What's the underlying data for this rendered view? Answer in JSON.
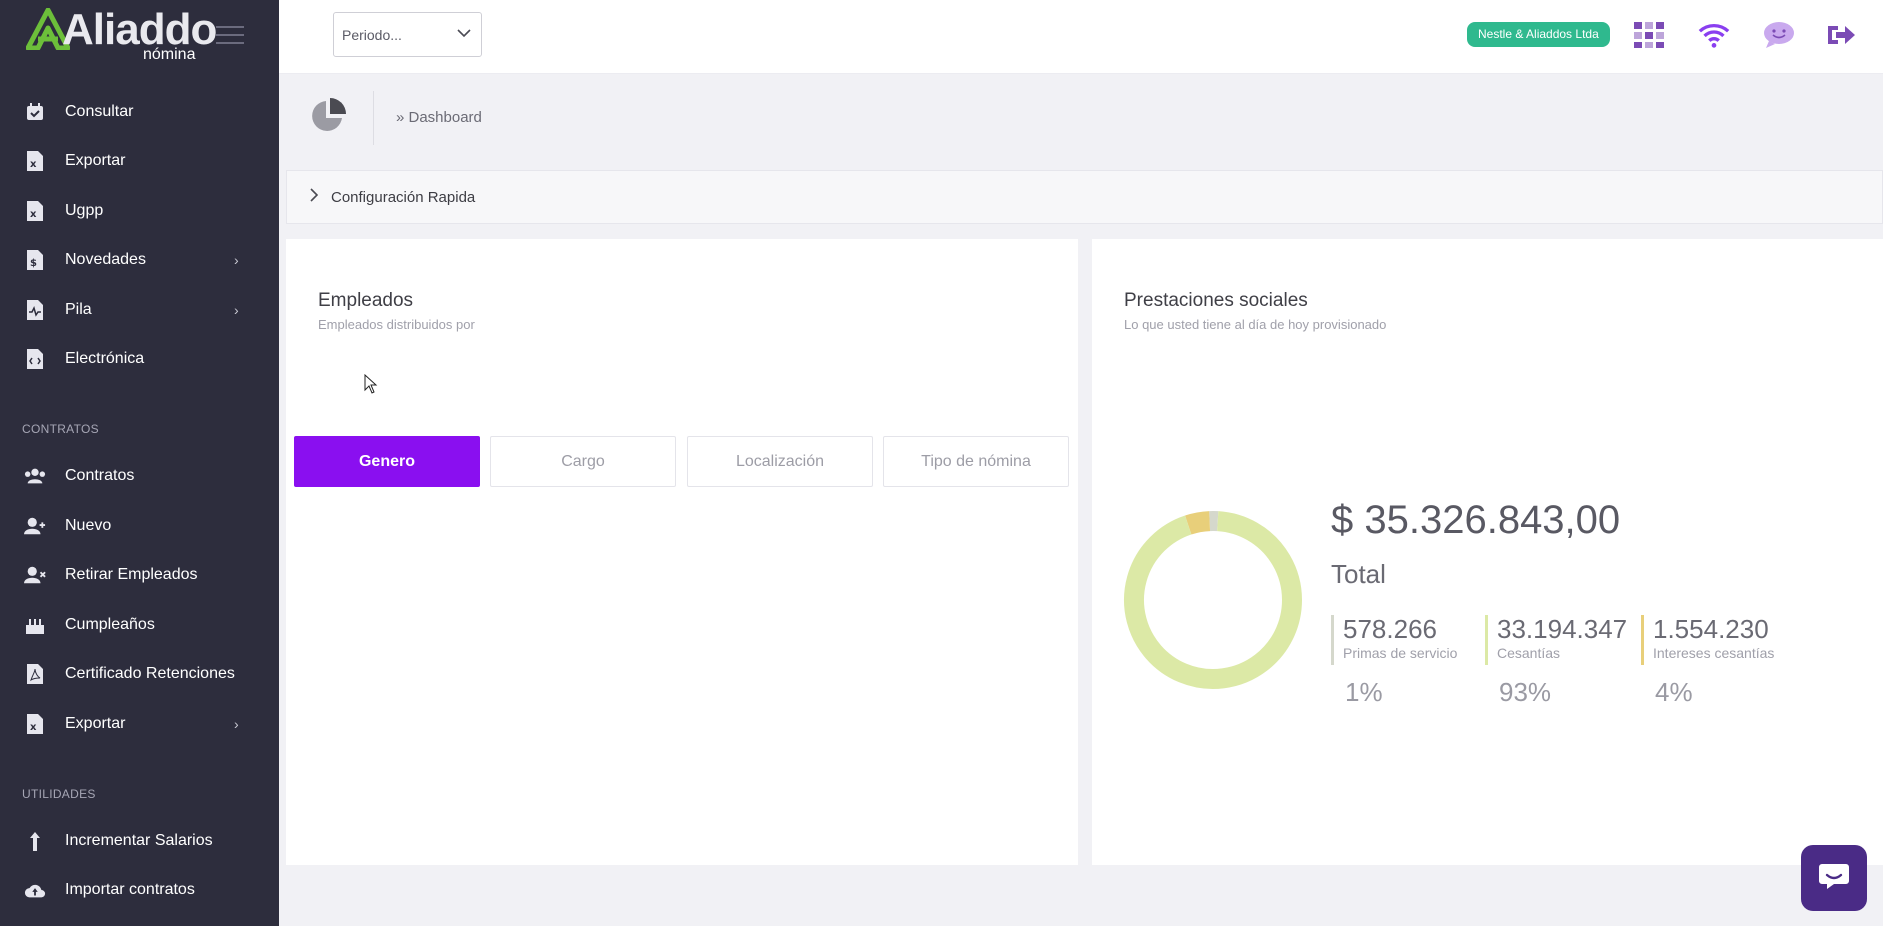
{
  "brand": {
    "name": "Aliaddo",
    "product": "nómina"
  },
  "sidebar": {
    "items": [
      {
        "label": "Consultar",
        "icon": "calendar-check-icon",
        "chevron": false
      },
      {
        "label": "Exportar",
        "icon": "excel-file-icon",
        "chevron": false
      },
      {
        "label": "Ugpp",
        "icon": "excel-file-icon",
        "chevron": false
      },
      {
        "label": "Novedades",
        "icon": "dollar-file-icon",
        "chevron": true
      },
      {
        "label": "Pila",
        "icon": "pulse-file-icon",
        "chevron": true
      },
      {
        "label": "Electrónica",
        "icon": "code-file-icon",
        "chevron": false
      }
    ],
    "section_contratos": "CONTRATOS",
    "contratos": [
      {
        "label": "Contratos",
        "icon": "users-icon"
      },
      {
        "label": "Nuevo",
        "icon": "user-plus-icon"
      },
      {
        "label": "Retirar Empleados",
        "icon": "user-times-icon"
      },
      {
        "label": "Cumpleaños",
        "icon": "birthday-cake-icon"
      },
      {
        "label": "Certificado Retenciones",
        "icon": "pdf-file-icon"
      },
      {
        "label": "Exportar",
        "icon": "excel-file-icon",
        "chevron": true
      }
    ],
    "section_utilidades": "UTILIDADES",
    "utilidades": [
      {
        "label": "Incrementar Salarios",
        "icon": "arrow-up-icon"
      },
      {
        "label": "Importar contratos",
        "icon": "cloud-upload-icon"
      }
    ]
  },
  "topbar": {
    "period_placeholder": "Periodo...",
    "company": "Nestle & Aliaddos Ltda",
    "accent": "#7b4bb5"
  },
  "breadcrumb": "» Dashboard",
  "quick_config": "Configuración Rapida",
  "employees": {
    "title": "Empleados",
    "subtitle": "Empleados distribuidos por",
    "tabs": [
      "Genero",
      "Cargo",
      "Localización",
      "Tipo de nómina"
    ],
    "active_tab": "Genero"
  },
  "benefits": {
    "title": "Prestaciones sociales",
    "subtitle": "Lo que usted tiene al día de hoy provisionado",
    "total_value": "$ 35.326.843,00",
    "total_label": "Total",
    "items": [
      {
        "value": "578.266",
        "label": "Primas de servicio",
        "percent": "1%",
        "color": "#d5d8cc"
      },
      {
        "value": "33.194.347",
        "label": "Cesantías",
        "percent": "93%",
        "color": "#dce9a6"
      },
      {
        "value": "1.554.230",
        "label": "Intereses cesantías",
        "percent": "4%",
        "color": "#e8cf7a"
      }
    ]
  },
  "chart_data": {
    "type": "pie",
    "categories": [
      "Primas de servicio",
      "Cesantías",
      "Intereses cesantías"
    ],
    "values": [
      578266,
      33194347,
      1554230
    ],
    "colors": [
      "#d5d8cc",
      "#dce9a6",
      "#e8cf7a"
    ]
  }
}
